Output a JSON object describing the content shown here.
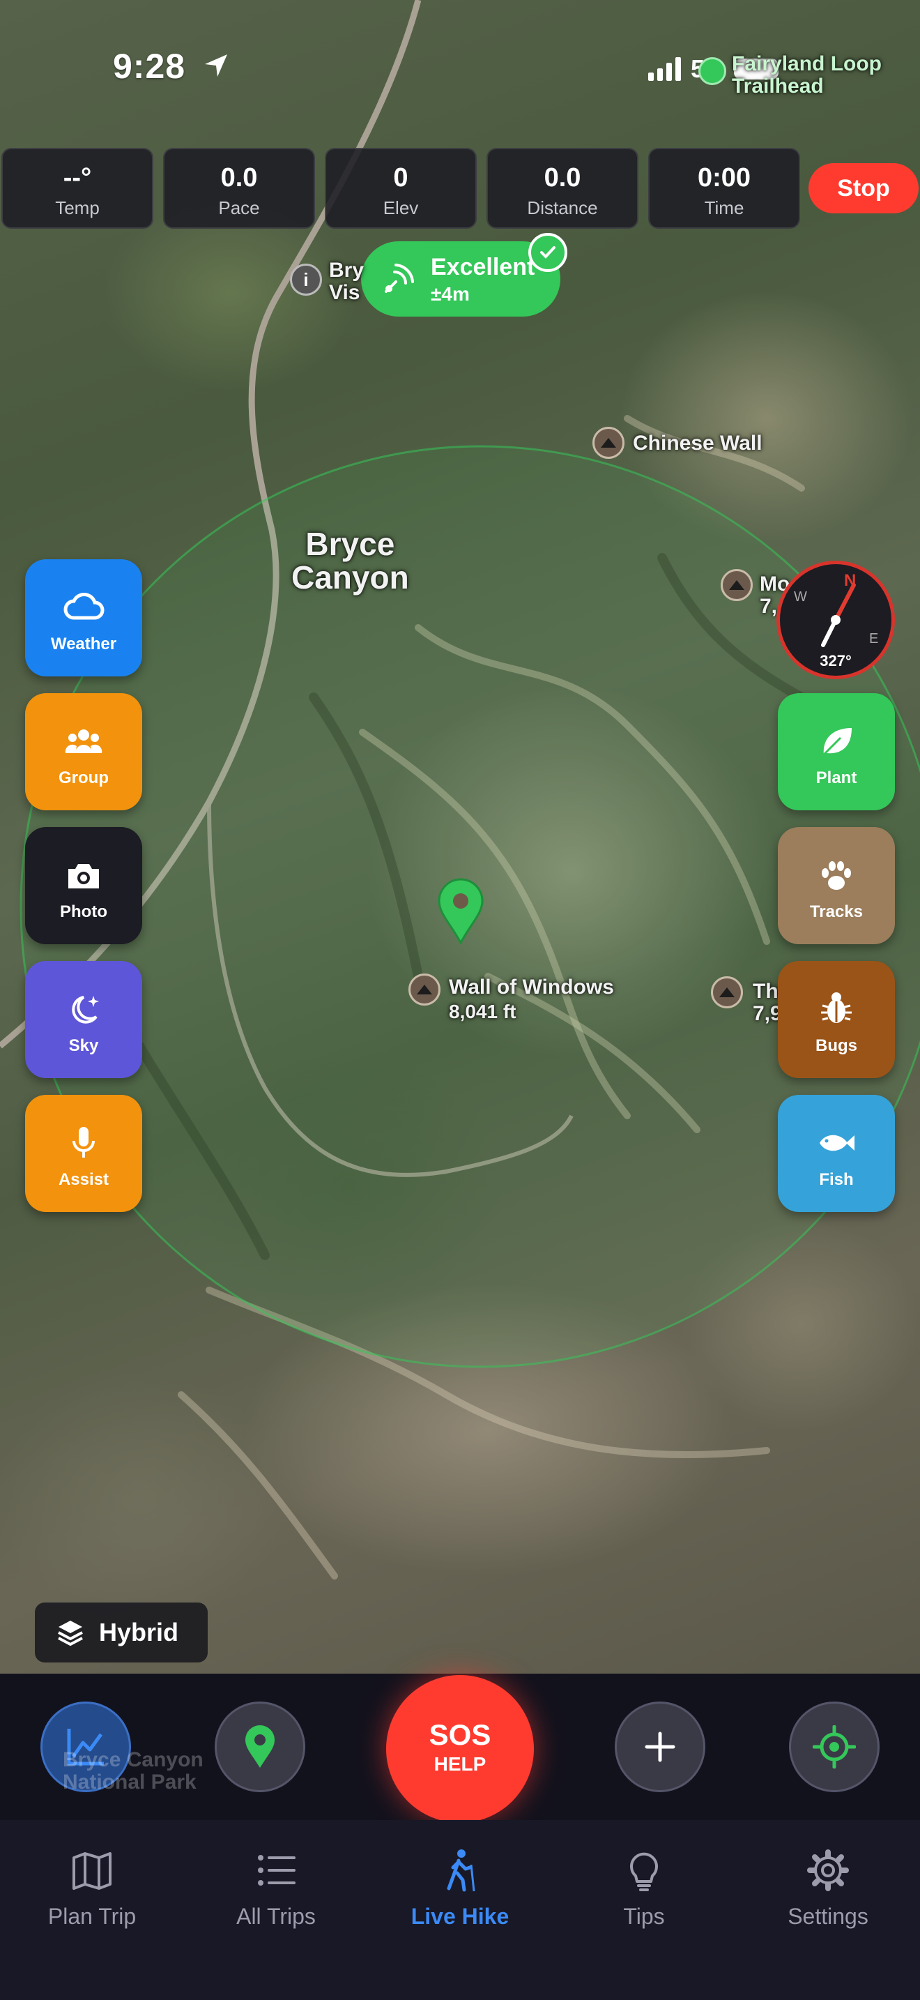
{
  "status_bar": {
    "time": "9:28",
    "network": "5G"
  },
  "stats": [
    {
      "value": "--°",
      "label": "Temp"
    },
    {
      "value": "0.0",
      "label": "Pace"
    },
    {
      "value": "0",
      "label": "Elev"
    },
    {
      "value": "0.0",
      "label": "Distance"
    },
    {
      "value": "0:00",
      "label": "Time"
    }
  ],
  "stop_label": "Stop",
  "gps": {
    "quality": "Excellent",
    "accuracy": "±4m"
  },
  "map_labels": {
    "area_title": "Bryce\nCanyon",
    "chinese_wall": "Chinese Wall",
    "wall_of_windows": "Wall of Windows",
    "wall_of_windows_elev": "8,041 ft",
    "bryce_visitor": "Bry\nVis",
    "fairyland": "Fairyland Loop\nTrailhead",
    "temple": "Mo     mple\n7,",
    "alligator": "The Alligator\n7,966 ft",
    "park_name": "Bryce Canyon\nNational Park"
  },
  "left_buttons": [
    {
      "label": "Weather",
      "icon": "cloud-icon",
      "color": "#1a82f0"
    },
    {
      "label": "Group",
      "icon": "group-icon",
      "color": "#f2920d"
    },
    {
      "label": "Photo",
      "icon": "camera-icon",
      "color": "#1c1c24"
    },
    {
      "label": "Sky",
      "icon": "moon-stars-icon",
      "color": "#5e56d8"
    },
    {
      "label": "Assist",
      "icon": "microphone-icon",
      "color": "#f2920d"
    }
  ],
  "right_buttons": [
    {
      "label": "Plant",
      "icon": "leaf-icon",
      "color": "#34c759"
    },
    {
      "label": "Tracks",
      "icon": "paw-icon",
      "color": "#9c7e5c"
    },
    {
      "label": "Bugs",
      "icon": "bug-icon",
      "color": "#9a5418"
    },
    {
      "label": "Fish",
      "icon": "fish-icon",
      "color": "#35a3d9"
    }
  ],
  "compass": {
    "heading": "327°",
    "north": "N",
    "west": "W",
    "east": "E"
  },
  "layer": {
    "label": "Hybrid"
  },
  "sos": {
    "main": "SOS",
    "sub": "HELP"
  },
  "tabs": [
    {
      "label": "Plan Trip",
      "icon": "map-icon"
    },
    {
      "label": "All Trips",
      "icon": "list-icon"
    },
    {
      "label": "Live Hike",
      "icon": "hiker-icon",
      "active": true
    },
    {
      "label": "Tips",
      "icon": "lightbulb-icon"
    },
    {
      "label": "Settings",
      "icon": "gear-icon"
    }
  ],
  "colors": {
    "accent": "#3b8af6",
    "danger": "#ff3b30",
    "success": "#34c759"
  }
}
